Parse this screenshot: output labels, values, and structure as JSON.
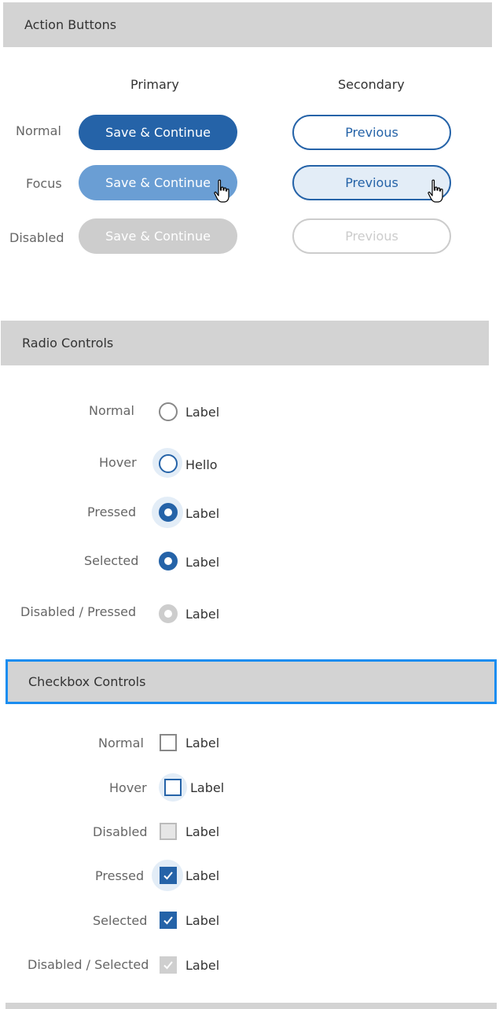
{
  "sections": {
    "actions": "Action Buttons",
    "radio": "Radio Controls",
    "checkbox": "Checkbox Controls"
  },
  "buttons": {
    "col_primary": "Primary",
    "col_secondary": "Secondary",
    "states": {
      "normal": "Normal",
      "focus": "Focus",
      "disabled": "Disabled"
    },
    "primary_label": "Save & Continue",
    "secondary_label": "Previous"
  },
  "radios": [
    {
      "state": "Normal",
      "label": "Label"
    },
    {
      "state": "Hover",
      "label": "Hello"
    },
    {
      "state": "Pressed",
      "label": "Label"
    },
    {
      "state": "Selected",
      "label": "Label"
    },
    {
      "state": "Disabled / Pressed",
      "label": "Label"
    }
  ],
  "checkboxes": [
    {
      "state": "Normal",
      "label": "Label"
    },
    {
      "state": "Hover",
      "label": "Label"
    },
    {
      "state": "Disabled",
      "label": "Label"
    },
    {
      "state": "Pressed",
      "label": "Label"
    },
    {
      "state": "Selected",
      "label": "Label"
    },
    {
      "state": "Disabled / Selected",
      "label": "Label"
    }
  ],
  "colors": {
    "accent": "#2563a8",
    "focus_primary": "#6a9ed4",
    "halo": "#e3edf7",
    "disabled": "#cdcdcd",
    "header_bg": "#d3d3d3",
    "selection_outline": "#1a8df0"
  },
  "icons": {
    "cursor": "hand-pointer-icon",
    "check": "checkmark-icon"
  }
}
